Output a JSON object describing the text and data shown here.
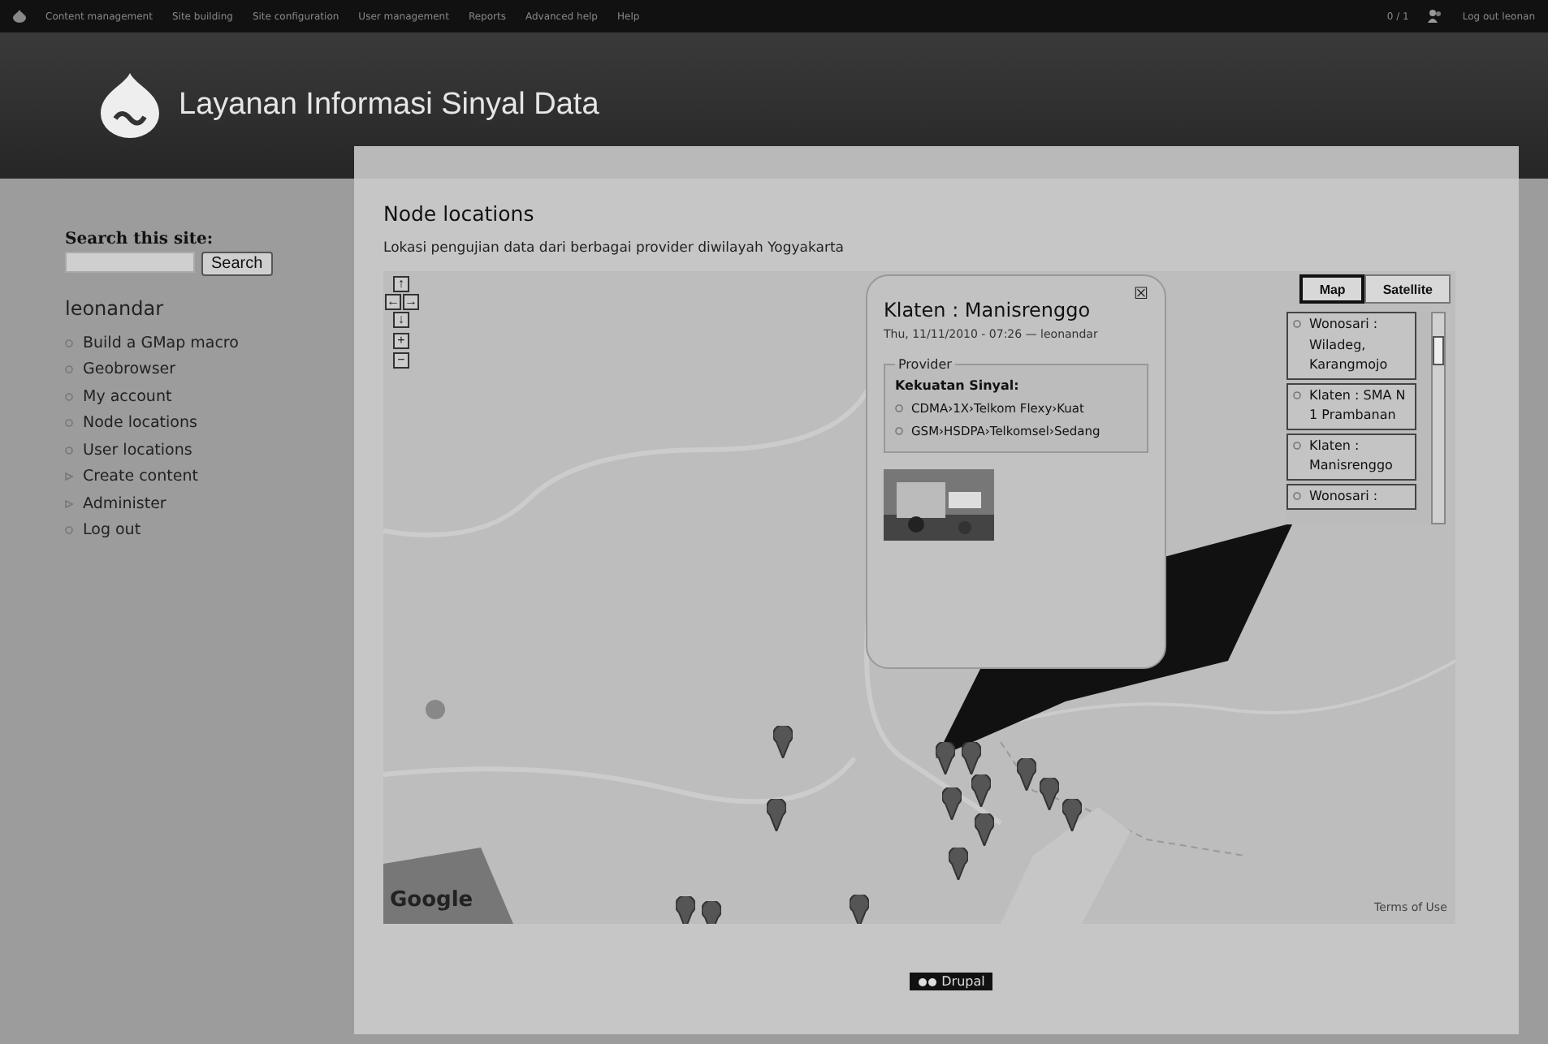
{
  "admin_bar": {
    "menu": [
      "Content management",
      "Site building",
      "Site configuration",
      "User management",
      "Reports",
      "Advanced help",
      "Help"
    ],
    "counter": "0 / 1",
    "logout": "Log out leonan"
  },
  "header": {
    "site_name": "Layanan Informasi Sinyal Data"
  },
  "sidebar": {
    "search": {
      "label": "Search this site:",
      "button": "Search"
    },
    "user_menu": {
      "title": "leonandar",
      "items": [
        {
          "label": "Build a GMap macro",
          "kind": "leaf"
        },
        {
          "label": "Geobrowser",
          "kind": "leaf"
        },
        {
          "label": "My account",
          "kind": "leaf"
        },
        {
          "label": "Node locations",
          "kind": "leaf"
        },
        {
          "label": "User locations",
          "kind": "leaf"
        },
        {
          "label": "Create content",
          "kind": "collapsed"
        },
        {
          "label": "Administer",
          "kind": "collapsed"
        },
        {
          "label": "Log out",
          "kind": "leaf"
        }
      ]
    }
  },
  "content": {
    "title": "Node locations",
    "description": "Lokasi pengujian data dari berbagai provider diwilayah Yogyakarta",
    "map": {
      "pan_controls": [
        "↑",
        "←",
        "→",
        "↓",
        "+",
        "−"
      ],
      "map_types": [
        {
          "label": "Map",
          "selected": true
        },
        {
          "label": "Satellite",
          "selected": false
        }
      ],
      "locations": [
        "Wonosari : Wiladeg, Karangmojo",
        "Klaten : SMA N 1 Prambanan",
        "Klaten : Manisrenggo",
        "Wonosari :"
      ],
      "logo": "Google",
      "terms": "Terms of Use",
      "popup": {
        "close": "☒",
        "title": "Klaten : Manisrenggo",
        "meta": "Thu, 11/11/2010 - 07:26 — leonandar",
        "fieldset": "Provider",
        "label": "Kekuatan Sinyal:",
        "values": [
          "CDMA›1X›Telkom Flexy›Kuat",
          "GSM›HSDPA›Telkomsel›Sedang"
        ]
      }
    }
  },
  "footer": {
    "badge": "Drupal"
  }
}
